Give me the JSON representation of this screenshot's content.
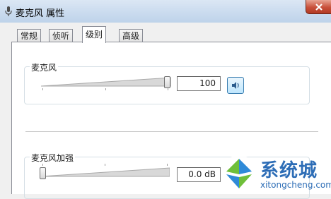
{
  "window": {
    "title": "麦克风 属性"
  },
  "tabs": [
    {
      "label": "常规",
      "active": false
    },
    {
      "label": "侦听",
      "active": false
    },
    {
      "label": "级别",
      "active": true
    },
    {
      "label": "高级",
      "active": false
    }
  ],
  "levels": [
    {
      "label": "麦克风",
      "slider_fraction": 1.0,
      "value": "100"
    },
    {
      "label": "麦克风加强",
      "slider_fraction": 0.0,
      "value": "0.0 dB"
    }
  ],
  "icons": {
    "title": "microphone-icon",
    "close": "close-icon",
    "speaker": "speaker-icon",
    "watermark_logo": "windows-logo-icon"
  },
  "watermark": {
    "name": "系统城",
    "url": "xitongcheng.com"
  },
  "colors": {
    "accent": "#2d6db6",
    "titlebar": "#c9daee",
    "close": "#c8503a"
  }
}
